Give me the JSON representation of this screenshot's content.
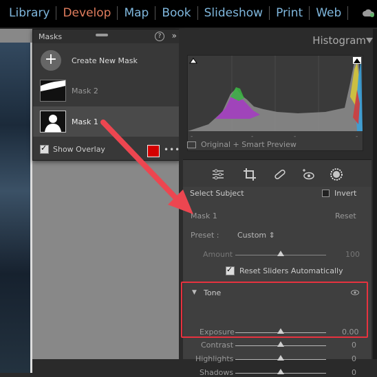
{
  "modules": [
    {
      "label": "Library",
      "active": false
    },
    {
      "label": "Develop",
      "active": true
    },
    {
      "label": "Map",
      "active": false
    },
    {
      "label": "Book",
      "active": false
    },
    {
      "label": "Slideshow",
      "active": false
    },
    {
      "label": "Print",
      "active": false
    },
    {
      "label": "Web",
      "active": false
    }
  ],
  "masks_panel": {
    "title": "Masks",
    "help": "?",
    "collapse": "»",
    "create_label": "Create New Mask",
    "items": [
      {
        "label": "Mask 2",
        "selected": false
      },
      {
        "label": "Mask 1",
        "selected": true
      }
    ],
    "show_overlay_label": "Show Overlay",
    "overlay_color": "#d40000",
    "more": "•••"
  },
  "histogram": {
    "title": "Histogram",
    "preview_label": "Original + Smart Preview"
  },
  "tools": [
    "sliders-icon",
    "crop-icon",
    "healing-icon",
    "redeye-icon",
    "masking-icon"
  ],
  "select_subject": {
    "label": "Select Subject",
    "invert_label": "Invert"
  },
  "mask_settings": {
    "name": "Mask 1",
    "reset": "Reset",
    "preset_label": "Preset :",
    "preset_value": "Custom ⇕",
    "amount_label": "Amount",
    "amount_value": "100",
    "amount_fraction": 1.0,
    "reset_sliders_label": "Reset Sliders Automatically",
    "tone_label": "Tone",
    "sliders": [
      {
        "label": "Exposure",
        "value": "0.00",
        "fraction": 0.5
      },
      {
        "label": "Contrast",
        "value": "0",
        "fraction": 0.5
      },
      {
        "label": "Highlights",
        "value": "0",
        "fraction": 0.5
      },
      {
        "label": "Shadows",
        "value": "0",
        "fraction": 0.5
      }
    ]
  },
  "colors": {
    "accent": "#e07d5e",
    "module": "#7fb7dd",
    "annotation": "#e8323f"
  }
}
